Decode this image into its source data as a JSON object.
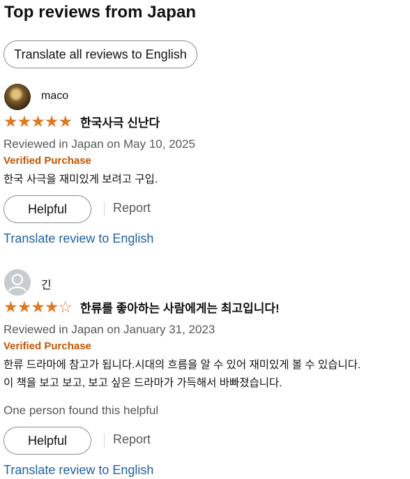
{
  "section": {
    "title": "Top reviews from Japan",
    "translate_all_label": "Translate all reviews to English"
  },
  "reviews": [
    {
      "reviewer": "maco",
      "avatar": "profile-photo",
      "stars": "★★★★★",
      "rating": 5,
      "title": "한국사극 신난다",
      "date": "Reviewed in Japan on May 10, 2025",
      "verified": "Verified Purchase",
      "body": [
        "한국 사극을 재미있게 보려고 구입."
      ],
      "helpful_count": "",
      "helpful_label": "Helpful",
      "report_label": "Report",
      "translate_label": "Translate review to English"
    },
    {
      "reviewer": "긴",
      "avatar": "default-user-icon",
      "stars": "★★★★☆",
      "rating": 4,
      "title": "한류를 좋아하는 사람에게는 최고입니다!",
      "date": "Reviewed in Japan on January 31, 2023",
      "verified": "Verified Purchase",
      "body": [
        "한류 드라마에 참고가 됩니다.시대의 흐름을 알 수 있어 재미있게 볼 수 있습니다.",
        "이 책을 보고 보고, 보고 싶은 드라마가 가득해서 바빠졌습니다."
      ],
      "helpful_count": "One person found this helpful",
      "helpful_label": "Helpful",
      "report_label": "Report",
      "translate_label": "Translate review to English"
    }
  ],
  "colors": {
    "star": "#de7921",
    "verified": "#c45500",
    "link": "#2162a1",
    "muted": "#565959"
  }
}
